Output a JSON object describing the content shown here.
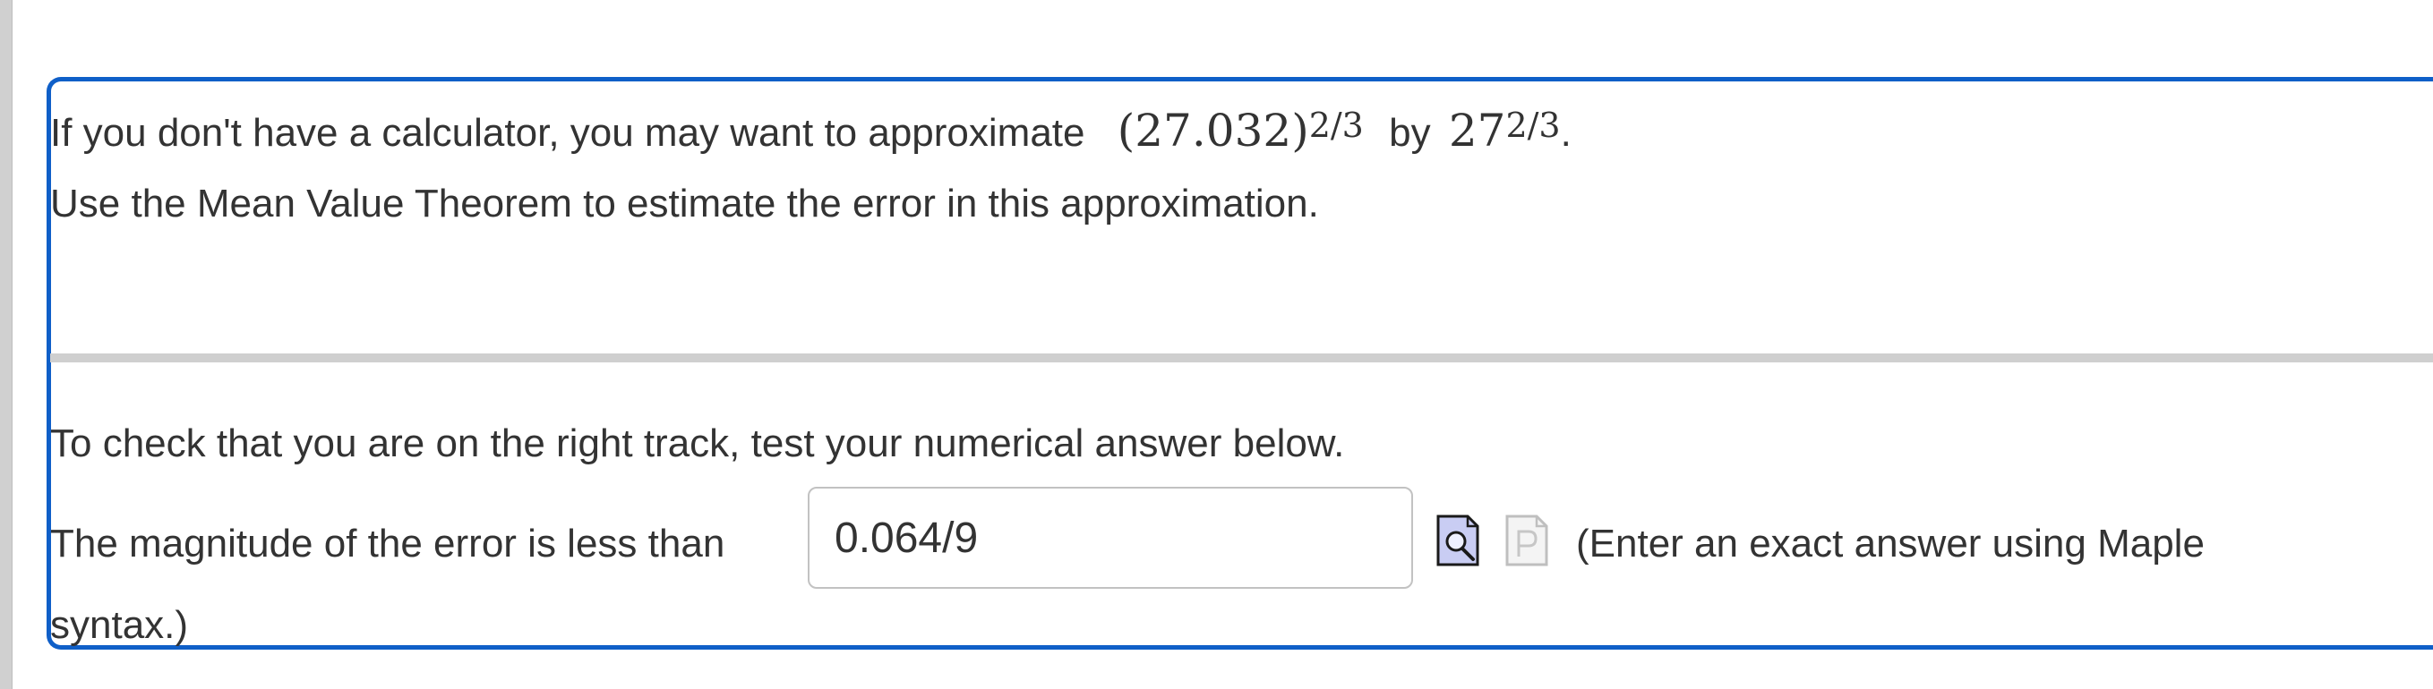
{
  "question": {
    "intro_prefix": "If you don't have a calculator, you may want to approximate",
    "expr_base": "(27.032)",
    "expr_exponent": "2/3",
    "by_word": "by",
    "approx_base": "27",
    "approx_exponent": "2/3",
    "period": ".",
    "instruction": "Use the Mean Value Theorem to estimate the error in this approximation."
  },
  "check": {
    "prompt": "To check that you are on the right track, test your numerical answer below.",
    "answer_label": "The magnitude of the error is less than",
    "answer_value": "0.064/9",
    "note_line1": "(Enter an exact answer using Maple",
    "note_line2": "syntax.)"
  },
  "icons": {
    "preview": "preview-magnifier-icon",
    "paste": "paste-document-icon"
  },
  "colors": {
    "box_border": "#0f5fc8",
    "divider": "#cfcfcf",
    "text": "#333333",
    "preview_icon": "#c9cdf3",
    "paste_icon": "#bfbfbf"
  }
}
